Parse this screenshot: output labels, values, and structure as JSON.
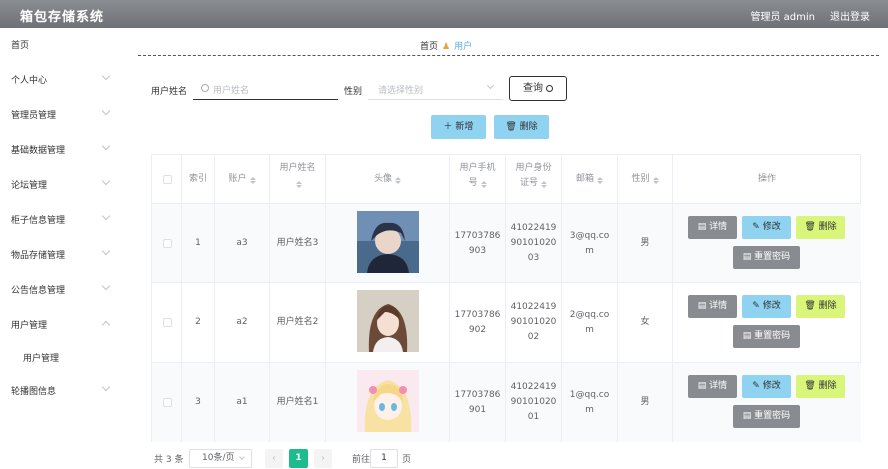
{
  "header": {
    "title": "箱包存储系统",
    "user": "管理员 admin",
    "logout": "退出登录"
  },
  "sidebar": {
    "items": [
      {
        "label": "首页"
      },
      {
        "label": "个人中心"
      },
      {
        "label": "管理员管理"
      },
      {
        "label": "基础数据管理"
      },
      {
        "label": "论坛管理"
      },
      {
        "label": "柜子信息管理"
      },
      {
        "label": "物品存储管理"
      },
      {
        "label": "公告信息管理"
      },
      {
        "label": "用户管理"
      },
      {
        "label": "用户管理"
      },
      {
        "label": "轮播图信息"
      }
    ]
  },
  "breadcrumb": {
    "home": "首页",
    "current": "用户"
  },
  "search": {
    "name_label": "用户姓名",
    "name_placeholder": "用户姓名",
    "gender_label": "性别",
    "gender_placeholder": "请选择性别",
    "query_label": "查询"
  },
  "actions": {
    "add": "新增",
    "delete": "删除"
  },
  "table": {
    "headers": [
      "索引",
      "账户",
      "用户姓名",
      "头像",
      "用户手机号",
      "用户身份证号",
      "邮箱",
      "性别",
      "操作"
    ],
    "rows": [
      {
        "index": "1",
        "account": "a3",
        "name": "用户姓名3",
        "phone": "17703786903",
        "idcard": "410224199010102003",
        "email": "3@qq.com",
        "gender": "男",
        "avatar": "avatar-boy-icon"
      },
      {
        "index": "2",
        "account": "a2",
        "name": "用户姓名2",
        "phone": "17703786902",
        "idcard": "410224199010102002",
        "email": "2@qq.com",
        "gender": "女",
        "avatar": "avatar-girl-photo-icon"
      },
      {
        "index": "3",
        "account": "a1",
        "name": "用户姓名1",
        "phone": "17703786901",
        "idcard": "410224199010102001",
        "email": "1@qq.com",
        "gender": "男",
        "avatar": "avatar-anime-girl-icon"
      }
    ],
    "op": {
      "detail": "详情",
      "edit": "修改",
      "delete": "删除",
      "reset": "重置密码"
    }
  },
  "pager": {
    "total": "共 3 条",
    "size": "10条/页",
    "page": "1",
    "goto": "前往",
    "goto_value": "1",
    "page_suffix": "页"
  },
  "colors": {
    "accent": "#1dbc8d",
    "topbar": "#7a7d81",
    "edit": "#8fd3f1",
    "delete": "#d9f57a",
    "detail": "#888c90"
  }
}
